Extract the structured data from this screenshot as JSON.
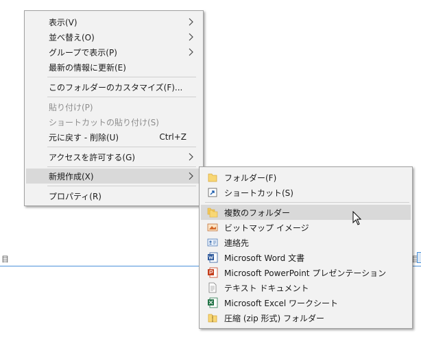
{
  "main_menu": {
    "items": [
      {
        "label": "表示(V)"
      },
      {
        "label": "並べ替え(O)"
      },
      {
        "label": "グループで表示(P)"
      },
      {
        "label": "最新の情報に更新(E)"
      },
      {
        "label": "このフォルダーのカスタマイズ(F)..."
      },
      {
        "label": "貼り付け(P)"
      },
      {
        "label": "ショートカットの貼り付け(S)"
      },
      {
        "label": "元に戻す - 削除(U)",
        "shortcut": "Ctrl+Z"
      },
      {
        "label": "アクセスを許可する(G)"
      },
      {
        "label": "新規作成(X)"
      },
      {
        "label": "プロパティ(R)"
      }
    ]
  },
  "new_submenu": {
    "items": [
      {
        "label": "フォルダー(F)",
        "icon": "folder-icon"
      },
      {
        "label": "ショートカット(S)",
        "icon": "shortcut-icon"
      },
      {
        "label": "複数のフォルダー",
        "icon": "multi-folder-icon"
      },
      {
        "label": "ビットマップ イメージ",
        "icon": "bitmap-icon"
      },
      {
        "label": "連絡先",
        "icon": "contact-icon"
      },
      {
        "label": "Microsoft Word 文書",
        "icon": "word-icon"
      },
      {
        "label": "Microsoft PowerPoint プレゼンテーション",
        "icon": "powerpoint-icon"
      },
      {
        "label": "テキスト ドキュメント",
        "icon": "text-document-icon"
      },
      {
        "label": "Microsoft Excel ワークシート",
        "icon": "excel-icon"
      },
      {
        "label": "圧縮 (zip 形式) フォルダー",
        "icon": "zip-folder-icon"
      }
    ]
  },
  "background": {
    "left_glyph": "目",
    "right_glyph": "目"
  },
  "colors": {
    "menu_bg": "#f2f2f2",
    "highlight": "#d9d9d9",
    "disabled_text": "#8d8d8d",
    "folder_yellow": "#f8d775",
    "accent_blue": "#4a90d9"
  }
}
